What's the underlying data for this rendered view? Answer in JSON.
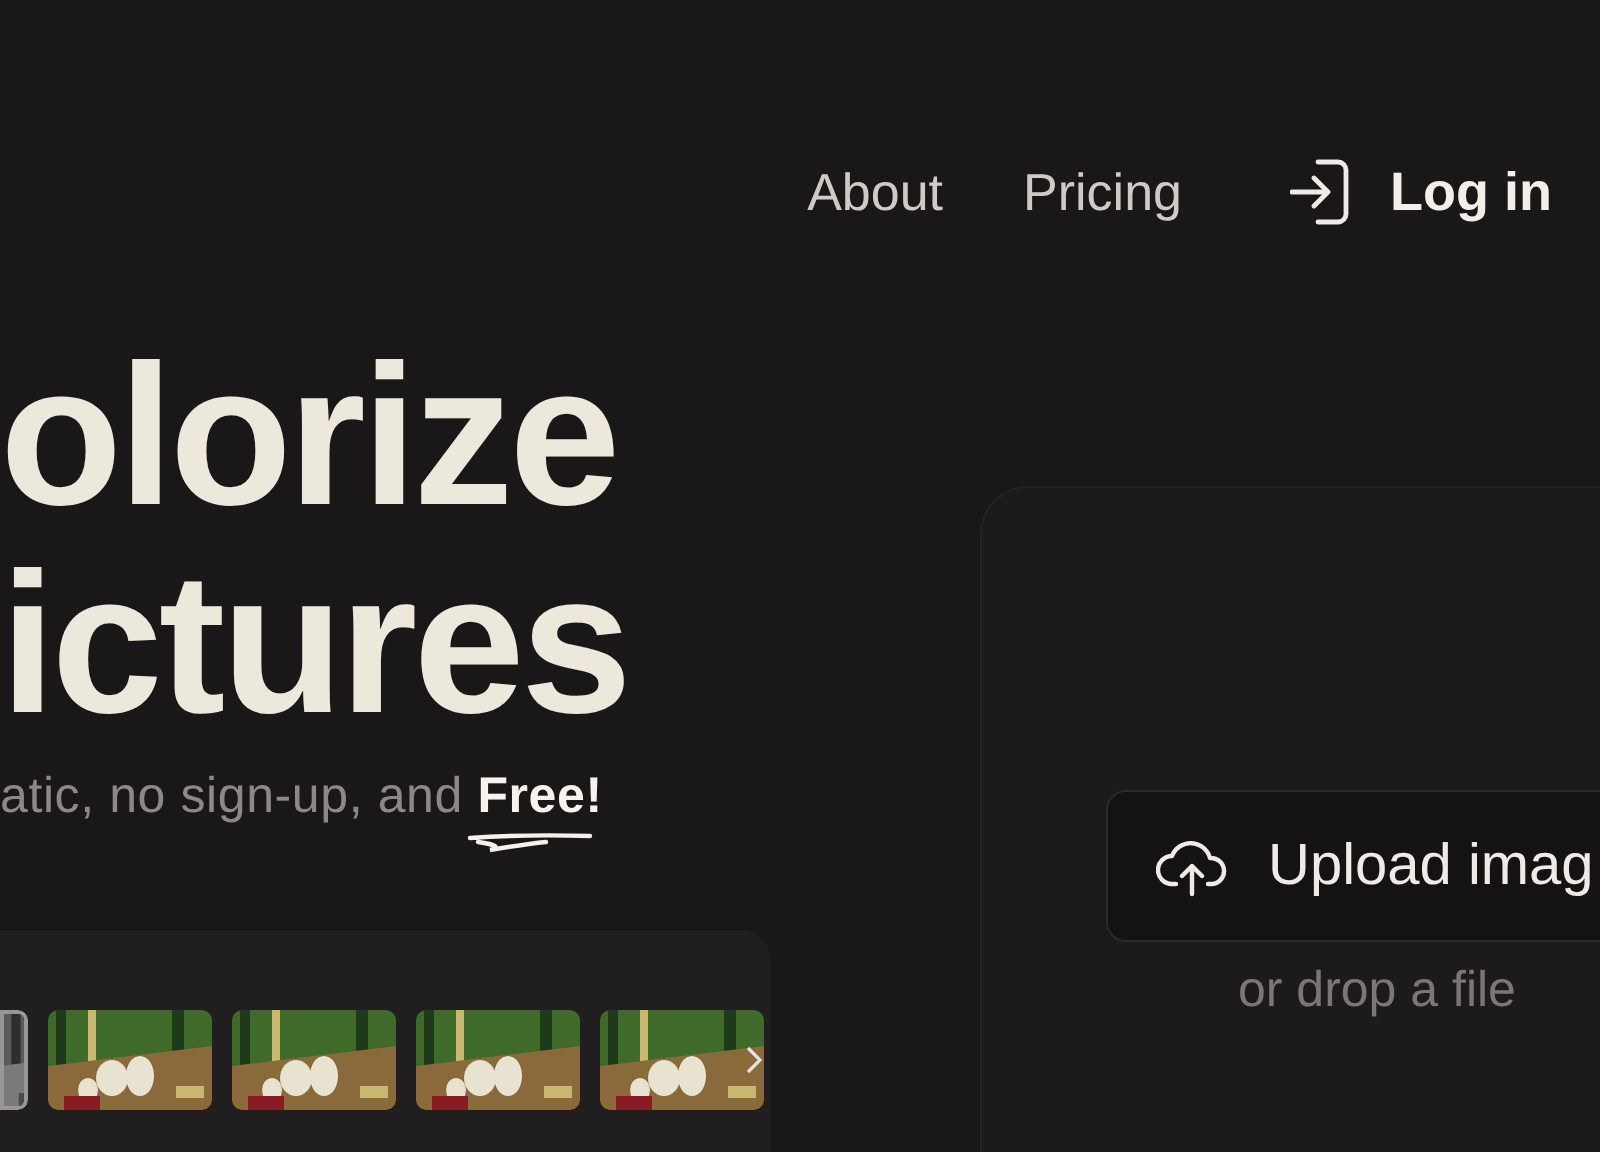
{
  "nav": [
    {
      "label": "About"
    },
    {
      "label": "Pricing"
    }
  ],
  "login": {
    "label": "Log in"
  },
  "hero": {
    "title_lines": [
      "olorize",
      "ictures"
    ],
    "subtitle": "atic, no sign-up, and **Free!**"
  },
  "gallery": {
    "thumbnails": [
      {
        "kind": "picture",
        "selected": true,
        "grayscale": true
      },
      {
        "kind": "picture",
        "selected": false,
        "grayscale": false
      },
      {
        "kind": "picture",
        "selected": false,
        "grayscale": false
      },
      {
        "kind": "picture",
        "selected": false,
        "grayscale": false
      },
      {
        "kind": "picture",
        "selected": false,
        "grayscale": false
      }
    ]
  },
  "upload": {
    "button": "Upload imag",
    "hint": "or drop a file"
  }
}
